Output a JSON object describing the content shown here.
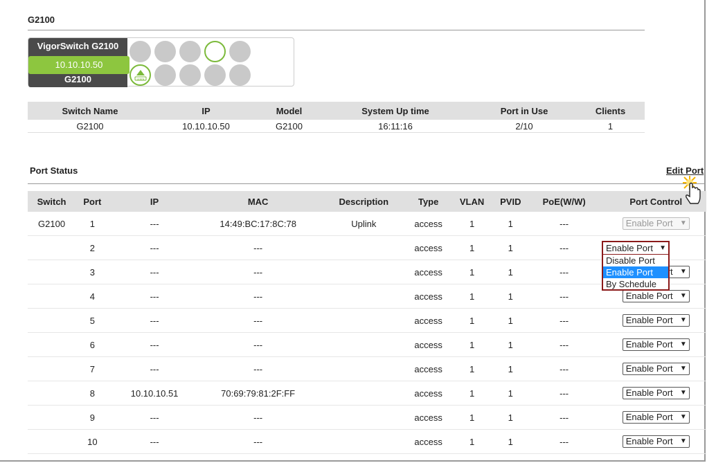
{
  "title": "G2100",
  "device": {
    "name": "VigorSwitch G2100",
    "ip": "10.10.10.50",
    "model": "G2100",
    "uplink_icon_text": "Uplink"
  },
  "summary": {
    "headers": [
      "Switch Name",
      "IP",
      "Model",
      "System Up time",
      "Port in Use",
      "Clients"
    ],
    "row": [
      "G2100",
      "10.10.10.50",
      "G2100",
      "16:11:16",
      "2/10",
      "1"
    ]
  },
  "port_status": {
    "label": "Port Status",
    "edit_link": "Edit Port",
    "headers": [
      "Switch",
      "Port",
      "IP",
      "MAC",
      "Description",
      "Type",
      "VLAN",
      "PVID",
      "PoE(W/W)",
      "Port Control"
    ],
    "rows": [
      {
        "switch": "G2100",
        "port": "1",
        "ip": "---",
        "mac": "14:49:BC:17:8C:78",
        "desc": "Uplink",
        "type": "access",
        "vlan": "1",
        "pvid": "1",
        "poe": "---",
        "control": "Enable Port"
      },
      {
        "switch": "",
        "port": "2",
        "ip": "---",
        "mac": "---",
        "desc": "",
        "type": "access",
        "vlan": "1",
        "pvid": "1",
        "poe": "---",
        "control": "Enable Port"
      },
      {
        "switch": "",
        "port": "3",
        "ip": "---",
        "mac": "---",
        "desc": "",
        "type": "access",
        "vlan": "1",
        "pvid": "1",
        "poe": "---",
        "control": "Enable Port"
      },
      {
        "switch": "",
        "port": "4",
        "ip": "---",
        "mac": "---",
        "desc": "",
        "type": "access",
        "vlan": "1",
        "pvid": "1",
        "poe": "---",
        "control": "Enable Port"
      },
      {
        "switch": "",
        "port": "5",
        "ip": "---",
        "mac": "---",
        "desc": "",
        "type": "access",
        "vlan": "1",
        "pvid": "1",
        "poe": "---",
        "control": "Enable Port"
      },
      {
        "switch": "",
        "port": "6",
        "ip": "---",
        "mac": "---",
        "desc": "",
        "type": "access",
        "vlan": "1",
        "pvid": "1",
        "poe": "---",
        "control": "Enable Port"
      },
      {
        "switch": "",
        "port": "7",
        "ip": "---",
        "mac": "---",
        "desc": "",
        "type": "access",
        "vlan": "1",
        "pvid": "1",
        "poe": "---",
        "control": "Enable Port"
      },
      {
        "switch": "",
        "port": "8",
        "ip": "10.10.10.51",
        "mac": "70:69:79:81:2F:FF",
        "desc": "",
        "type": "access",
        "vlan": "1",
        "pvid": "1",
        "poe": "---",
        "control": "Enable Port"
      },
      {
        "switch": "",
        "port": "9",
        "ip": "---",
        "mac": "---",
        "desc": "",
        "type": "access",
        "vlan": "1",
        "pvid": "1",
        "poe": "---",
        "control": "Enable Port"
      },
      {
        "switch": "",
        "port": "10",
        "ip": "---",
        "mac": "---",
        "desc": "",
        "type": "access",
        "vlan": "1",
        "pvid": "1",
        "poe": "---",
        "control": "Enable Port"
      }
    ]
  },
  "dropdown": {
    "current": "Enable Port",
    "options": [
      "Disable Port",
      "Enable Port",
      "By Schedule"
    ],
    "highlighted": "Enable Port"
  },
  "colors": {
    "accent_green": "#8dc63f",
    "highlight_blue": "#1e90ff",
    "dropdown_border": "#8b1a1a"
  }
}
